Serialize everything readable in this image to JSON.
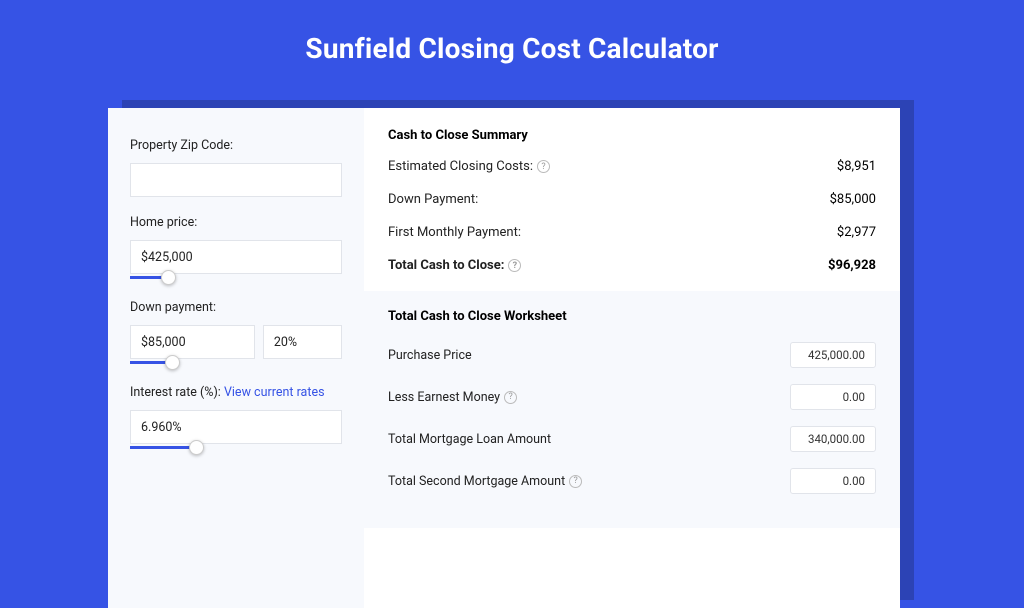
{
  "title": "Sunfield Closing Cost Calculator",
  "inputs": {
    "zip_label": "Property Zip Code:",
    "zip_value": "",
    "home_price_label": "Home price:",
    "home_price_value": "$425,000",
    "home_price_slider_pct": 18,
    "down_payment_label": "Down payment:",
    "down_payment_value": "$85,000",
    "down_payment_pct_value": "20%",
    "down_payment_slider_pct": 20,
    "interest_label_prefix": "Interest rate (%): ",
    "interest_link": "View current rates",
    "interest_value": "6.960%",
    "interest_slider_pct": 31
  },
  "summary": {
    "heading": "Cash to Close Summary",
    "rows": [
      {
        "label": "Estimated Closing Costs:",
        "help": true,
        "value": "$8,951",
        "bold": false
      },
      {
        "label": "Down Payment:",
        "help": false,
        "value": "$85,000",
        "bold": false
      },
      {
        "label": "First Monthly Payment:",
        "help": false,
        "value": "$2,977",
        "bold": false
      },
      {
        "label": "Total Cash to Close:",
        "help": true,
        "value": "$96,928",
        "bold": true
      }
    ]
  },
  "worksheet": {
    "heading": "Total Cash to Close Worksheet",
    "rows": [
      {
        "label": "Purchase Price",
        "help": false,
        "value": "425,000.00"
      },
      {
        "label": "Less Earnest Money",
        "help": true,
        "value": "0.00"
      },
      {
        "label": "Total Mortgage Loan Amount",
        "help": false,
        "value": "340,000.00"
      },
      {
        "label": "Total Second Mortgage Amount",
        "help": true,
        "value": "0.00"
      }
    ]
  }
}
